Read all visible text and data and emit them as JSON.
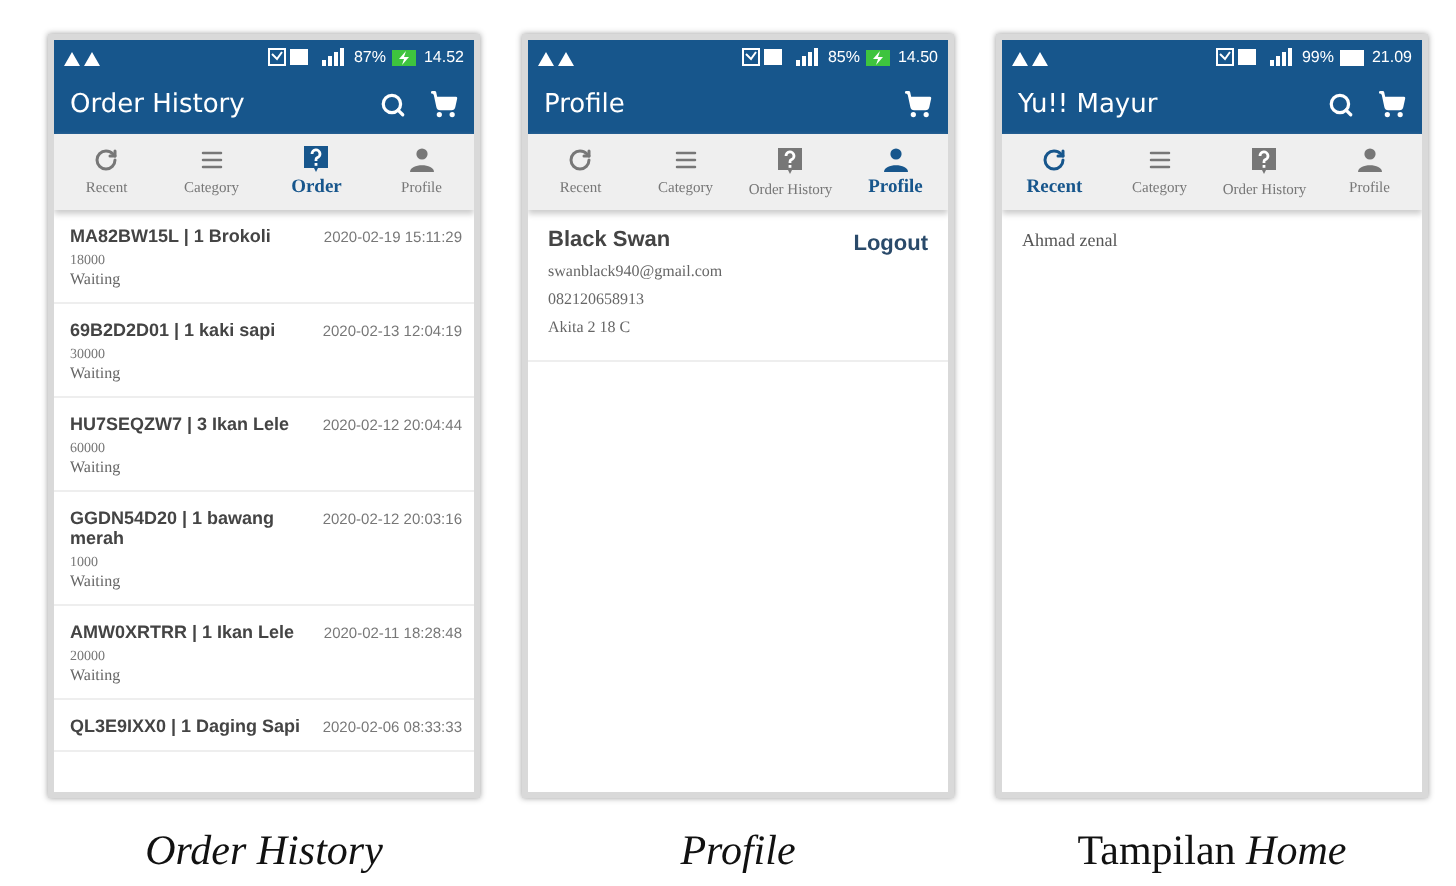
{
  "screens": [
    {
      "status": {
        "battery": "87%",
        "time": "14.52",
        "charging": true
      },
      "title": "Order History",
      "actions": [
        {
          "kind": "search"
        },
        {
          "kind": "cart"
        }
      ],
      "tabs": [
        {
          "label": "Recent",
          "selected": false
        },
        {
          "label": "Category",
          "selected": false
        },
        {
          "label": "Order",
          "selected": true
        },
        {
          "label": "Profile",
          "selected": false
        }
      ],
      "content": {
        "kind": "orders",
        "orders": [
          {
            "title": "MA82BW15L | 1 Brokoli",
            "date": "2020-02-19 15:11:29",
            "price": "18000",
            "status": "Waiting"
          },
          {
            "title": "69B2D2D01 | 1 kaki sapi",
            "date": "2020-02-13 12:04:19",
            "price": "30000",
            "status": "Waiting"
          },
          {
            "title": "HU7SEQZW7 | 3 Ikan Lele",
            "date": "2020-02-12 20:04:44",
            "price": "60000",
            "status": "Waiting"
          },
          {
            "title": "GGDN54D20 | 1 bawang merah",
            "date": "2020-02-12 20:03:16",
            "price": "1000",
            "status": "Waiting"
          },
          {
            "title": "AMW0XRTRR | 1 Ikan Lele",
            "date": "2020-02-11 18:28:48",
            "price": "20000",
            "status": "Waiting"
          },
          {
            "title": "QL3E9IXX0 | 1 Daging Sapi",
            "date": "2020-02-06 08:33:33"
          }
        ]
      },
      "caption": "Order History",
      "caption_italic": true
    },
    {
      "status": {
        "battery": "85%",
        "time": "14.50",
        "charging": true
      },
      "title": "Profile",
      "actions": [
        {
          "kind": "cart"
        }
      ],
      "tabs": [
        {
          "label": "Recent",
          "selected": false
        },
        {
          "label": "Category",
          "selected": false
        },
        {
          "label": "Order History",
          "selected": false
        },
        {
          "label": "Profile",
          "selected": true
        }
      ],
      "content": {
        "kind": "profile",
        "name": "Black Swan",
        "email": "swanblack940@gmail.com",
        "phone": "082120658913",
        "address": "Akita 2 18 C",
        "button": "Logout"
      },
      "caption": "Profile",
      "caption_italic": true
    },
    {
      "status": {
        "battery": "99%",
        "time": "21.09",
        "charging": false
      },
      "title": "Yu!! Mayur",
      "actions": [
        {
          "kind": "search"
        },
        {
          "kind": "cart"
        }
      ],
      "tabs": [
        {
          "label": "Recent",
          "selected": true
        },
        {
          "label": "Category",
          "selected": false
        },
        {
          "label": "Order History",
          "selected": false
        },
        {
          "label": "Profile",
          "selected": false
        }
      ],
      "content": {
        "kind": "text",
        "text": "Ahmad zenal"
      },
      "caption": "Tampilan *Home*",
      "caption_italic": false
    }
  ]
}
